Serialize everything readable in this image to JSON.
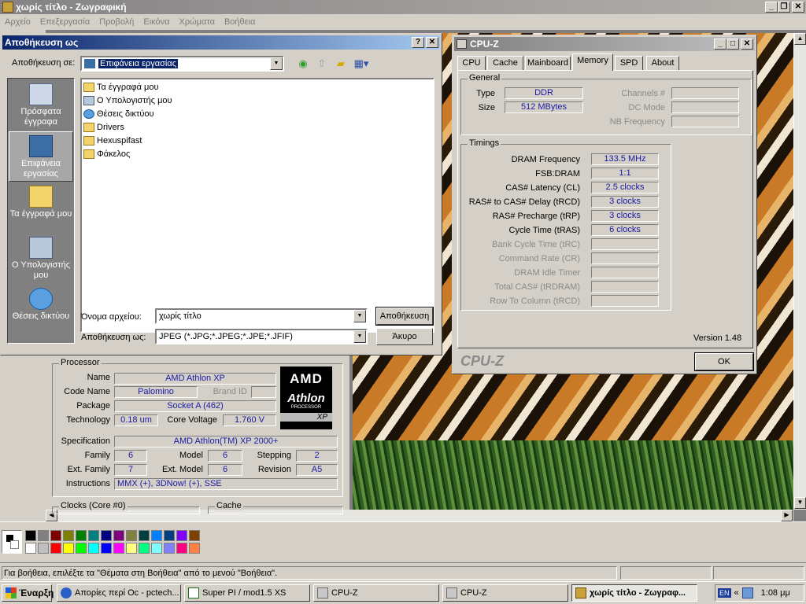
{
  "paint": {
    "title": "χωρίς τίτλο - Ζωγραφική",
    "menu": [
      "Αρχείο",
      "Επεξεργασία",
      "Προβολή",
      "Εικόνα",
      "Χρώματα",
      "Βοήθεια"
    ],
    "status": "Για βοήθεια, επιλέξτε τα \"Θέματα στη Βοήθεια\" από το μενού \"Βοήθεια\".",
    "palette": [
      "#000000",
      "#808080",
      "#800000",
      "#808000",
      "#008000",
      "#008080",
      "#000080",
      "#800080",
      "#808040",
      "#004040",
      "#0080ff",
      "#004080",
      "#8000ff",
      "#804000",
      "#ffffff",
      "#c0c0c0",
      "#ff0000",
      "#ffff00",
      "#00ff00",
      "#00ffff",
      "#0000ff",
      "#ff00ff",
      "#ffff80",
      "#00ff80",
      "#80ffff",
      "#8080ff",
      "#ff0080",
      "#ff8040"
    ]
  },
  "save_dialog": {
    "title": "Αποθήκευση ως",
    "help_glyph": "?",
    "close_glyph": "✕",
    "save_in_label": "Αποθήκευση σε:",
    "save_in_value": "Επιφάνεια εργασίας",
    "places": [
      "Πρόσφατα έγγραφα",
      "Επιφάνεια εργασίας",
      "Τα έγγραφά μου",
      "Ο Υπολογιστής μου",
      "Θέσεις δικτύου"
    ],
    "files": [
      "Τα έγγραφά μου",
      "Ο Υπολογιστής μου",
      "Θέσεις δικτύου",
      "Drivers",
      "Hexuspifast",
      "Φάκελος"
    ],
    "filename_label": "Όνομα αρχείου:",
    "filename_value": "χωρίς τίτλο",
    "type_label": "Αποθήκευση ως:",
    "type_value": "JPEG (*.JPG;*.JPEG;*.JPE;*.JFIF)",
    "save_button": "Αποθήκευση",
    "cancel_button": "Άκυρο"
  },
  "cpuz_cpu": {
    "group": "Processor",
    "name_label": "Name",
    "name": "AMD Athlon XP",
    "codename_label": "Code Name",
    "codename": "Palomino",
    "brandid_label": "Brand ID",
    "package_label": "Package",
    "package": "Socket A (462)",
    "tech_label": "Technology",
    "tech": "0.18 um",
    "voltage_label": "Core Voltage",
    "voltage": "1.760 V",
    "spec_label": "Specification",
    "spec": "AMD Athlon(TM) XP 2000+",
    "family_label": "Family",
    "family": "6",
    "model_label": "Model",
    "model": "6",
    "stepping_label": "Stepping",
    "stepping": "2",
    "extfamily_label": "Ext. Family",
    "extfamily": "7",
    "extmodel_label": "Ext. Model",
    "extmodel": "6",
    "revision_label": "Revision",
    "revision": "A5",
    "instr_label": "Instructions",
    "instr": "MMX (+), 3DNow! (+), SSE",
    "clocks_group": "Clocks (Core #0)",
    "cache_group": "Cache",
    "logo_amd": "AMD",
    "logo_athlon": "Athlon",
    "logo_sub": "PROCESSOR",
    "logo_xp": "XP"
  },
  "cpuz_mem": {
    "title": "CPU-Z",
    "tabs": [
      "CPU",
      "Cache",
      "Mainboard",
      "Memory",
      "SPD",
      "About"
    ],
    "general_group": "General",
    "type_label": "Type",
    "type": "DDR",
    "size_label": "Size",
    "size": "512 MBytes",
    "channels_label": "Channels #",
    "dcmode_label": "DC Mode",
    "nbfreq_label": "NB Frequency",
    "timings_group": "Timings",
    "timings": [
      {
        "label": "DRAM Frequency",
        "value": "133.5 MHz",
        "enabled": true
      },
      {
        "label": "FSB:DRAM",
        "value": "1:1",
        "enabled": true
      },
      {
        "label": "CAS# Latency (CL)",
        "value": "2.5 clocks",
        "enabled": true
      },
      {
        "label": "RAS# to CAS# Delay (tRCD)",
        "value": "3 clocks",
        "enabled": true
      },
      {
        "label": "RAS# Precharge (tRP)",
        "value": "3 clocks",
        "enabled": true
      },
      {
        "label": "Cycle Time (tRAS)",
        "value": "6 clocks",
        "enabled": true
      },
      {
        "label": "Bank Cycle Time (tRC)",
        "value": "",
        "enabled": false
      },
      {
        "label": "Command Rate (CR)",
        "value": "",
        "enabled": false
      },
      {
        "label": "DRAM Idle Timer",
        "value": "",
        "enabled": false
      },
      {
        "label": "Total CAS# (tRDRAM)",
        "value": "",
        "enabled": false
      },
      {
        "label": "Row To Column (tRCD)",
        "value": "",
        "enabled": false
      }
    ],
    "version": "Version 1.48",
    "brand": "CPU-Z",
    "ok_button": "OK"
  },
  "taskbar": {
    "start": "Έναρξη",
    "tasks": [
      "Απορίες περί Oc - pctech...",
      "Super PI / mod1.5 XS",
      "CPU-Z",
      "CPU-Z",
      "χωρίς τίτλο - Ζωγραφ..."
    ],
    "lang": "EN",
    "chevron": "«",
    "time": "1:08 μμ"
  }
}
